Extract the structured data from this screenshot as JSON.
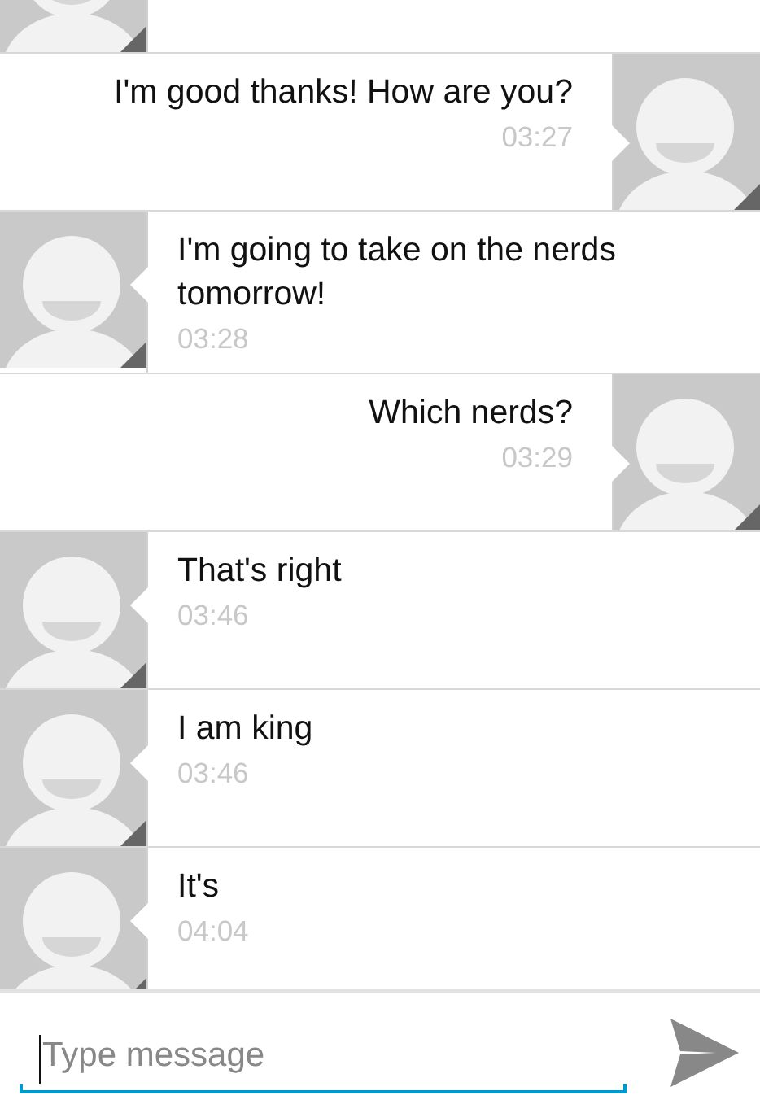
{
  "messages": [
    {
      "kind": "received"
    },
    {
      "kind": "sent",
      "text": "I'm good thanks! How are you?",
      "time": "03:27"
    },
    {
      "kind": "received",
      "text": "I'm going to take on the nerds tomorrow!",
      "time": "03:28"
    },
    {
      "kind": "sent",
      "text": "Which nerds?",
      "time": "03:29"
    },
    {
      "kind": "received",
      "text": "That's right",
      "time": "03:46"
    },
    {
      "kind": "received",
      "text": "I am king",
      "time": "03:46"
    },
    {
      "kind": "received",
      "text": "It's",
      "time": "04:04"
    }
  ],
  "composer": {
    "placeholder": "Type message"
  }
}
